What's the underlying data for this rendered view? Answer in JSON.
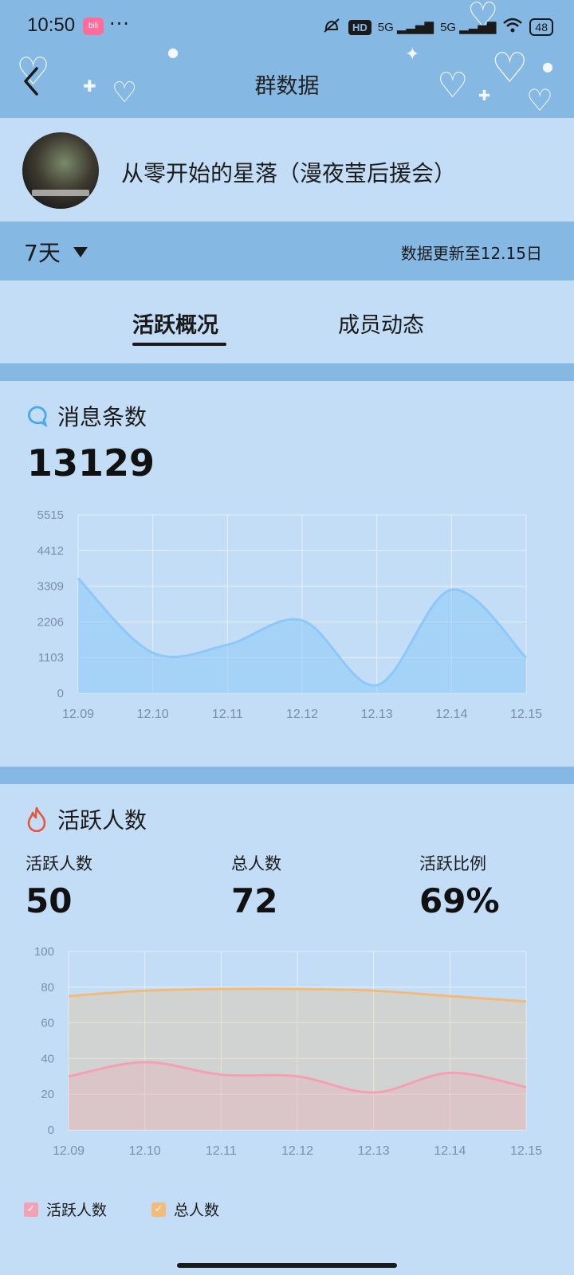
{
  "status_bar": {
    "time": "10:50",
    "app_badge": "bili",
    "more": "···",
    "hd": "HD",
    "signal_1": "5G",
    "signal_2": "5G",
    "battery": "48"
  },
  "header": {
    "title": "群数据"
  },
  "group": {
    "name": "从零开始的星落（漫夜莹后援会）"
  },
  "filter": {
    "range": "7天",
    "update_text": "数据更新至12.15日"
  },
  "tabs": [
    {
      "label": "活跃概况",
      "active": true
    },
    {
      "label": "成员动态",
      "active": false
    }
  ],
  "messages": {
    "heading": "消息条数",
    "total": "13129",
    "icon": "chat-bubble-icon",
    "color": "#8ec8f8"
  },
  "active": {
    "heading": "活跃人数",
    "icon": "flame-icon",
    "stats": [
      {
        "label": "活跃人数",
        "value": "50"
      },
      {
        "label": "总人数",
        "value": "72"
      },
      {
        "label": "活跃比例",
        "value": "69%"
      }
    ],
    "legend": [
      {
        "label": "活跃人数",
        "color": "#f4a0b5"
      },
      {
        "label": "总人数",
        "color": "#f4bb78"
      }
    ]
  },
  "chart_data": [
    {
      "type": "area",
      "title": "消息条数",
      "x": [
        "12.09",
        "12.10",
        "12.11",
        "12.12",
        "12.13",
        "12.14",
        "12.15"
      ],
      "y_ticks": [
        "0",
        "1103",
        "2206",
        "3309",
        "4412",
        "5515"
      ],
      "ylim": [
        0,
        5515
      ],
      "series": [
        {
          "values": [
            3550,
            1250,
            1500,
            2250,
            250,
            3200,
            1100
          ],
          "color": "#8ec8f8"
        }
      ],
      "grid": true
    },
    {
      "type": "area",
      "title": "活跃人数",
      "x": [
        "12.09",
        "12.10",
        "12.11",
        "12.12",
        "12.13",
        "12.14",
        "12.15"
      ],
      "y_ticks": [
        "0",
        "20",
        "40",
        "60",
        "80",
        "100"
      ],
      "ylim": [
        0,
        100
      ],
      "series": [
        {
          "name": "活跃人数",
          "values": [
            30,
            38,
            31,
            30,
            21,
            32,
            24
          ],
          "color": "#f4a0b5"
        },
        {
          "name": "总人数",
          "values": [
            75,
            78,
            79,
            79,
            78,
            75,
            72
          ],
          "color": "#f4bb78"
        }
      ],
      "grid": true,
      "legend": "bottom-left"
    }
  ]
}
